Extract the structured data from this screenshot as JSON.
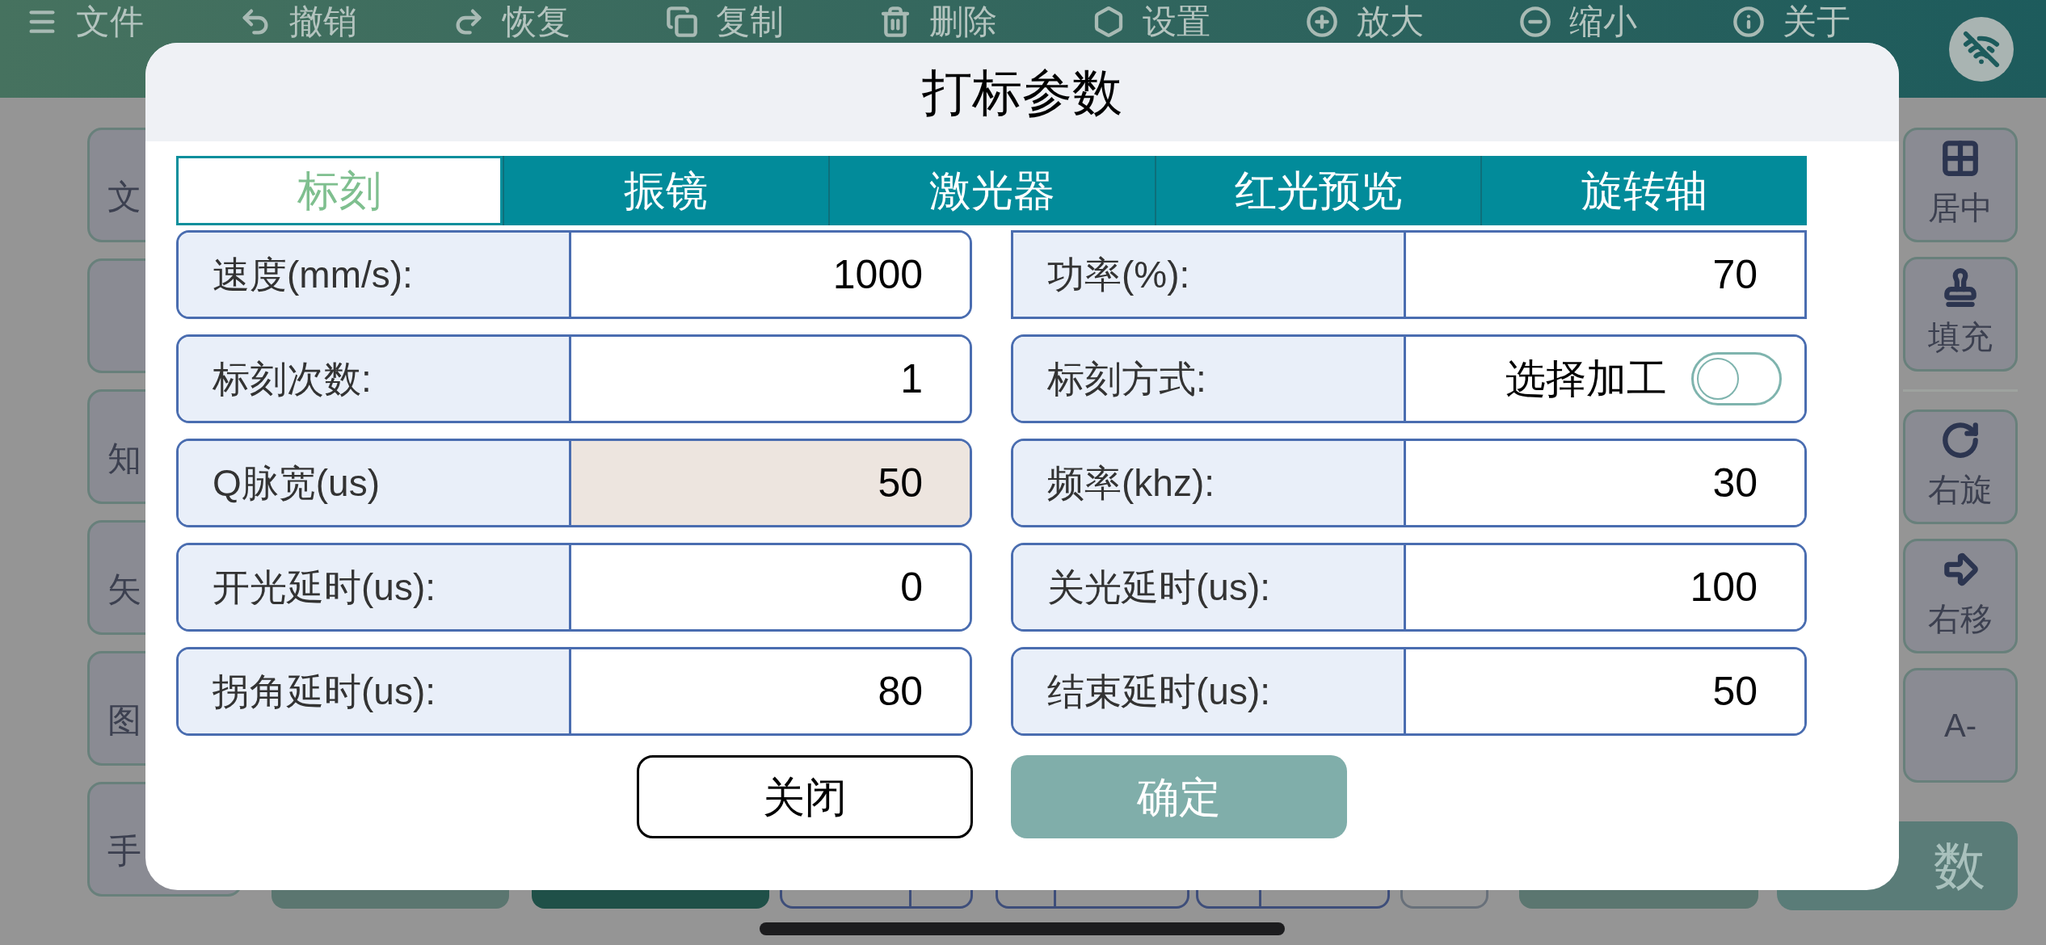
{
  "toolbar": {
    "items": [
      {
        "label": "文件"
      },
      {
        "label": "撤销"
      },
      {
        "label": "恢复"
      },
      {
        "label": "复制"
      },
      {
        "label": "删除"
      },
      {
        "label": "设置"
      },
      {
        "label": "放大"
      },
      {
        "label": "缩小"
      },
      {
        "label": "关于"
      }
    ]
  },
  "left_tools": [
    {
      "kind": "labeled",
      "label": "文"
    },
    {
      "kind": "blank"
    },
    {
      "kind": "labeled",
      "label": "知"
    },
    {
      "kind": "labeled",
      "label": "矢"
    },
    {
      "kind": "labeled",
      "label": "图"
    },
    {
      "kind": "labeled",
      "label": "手"
    }
  ],
  "right_tools": [
    {
      "label": "居中",
      "kind": "tool"
    },
    {
      "label": "填充",
      "kind": "tool"
    },
    {
      "label": "右旋",
      "kind": "tool"
    },
    {
      "label": "右移",
      "kind": "tool"
    },
    {
      "label": "A-",
      "kind": "tool"
    },
    {
      "label": "数",
      "kind": "primary"
    }
  ],
  "dialog": {
    "title": "打标参数",
    "tabs": [
      {
        "label": "标刻",
        "selected": true
      },
      {
        "label": "振镜",
        "selected": false
      },
      {
        "label": "激光器",
        "selected": false
      },
      {
        "label": "红光预览",
        "selected": false
      },
      {
        "label": "旋转轴",
        "selected": false
      }
    ],
    "fields": [
      {
        "kind": "input",
        "label": "速度(mm/s):",
        "value": "1000",
        "focused": false
      },
      {
        "kind": "input",
        "label": "功率(%):",
        "value": "70",
        "focused": false
      },
      {
        "kind": "input",
        "label": "标刻次数:",
        "value": "1",
        "focused": false
      },
      {
        "kind": "toggle",
        "label": "标刻方式:",
        "value": "选择加工",
        "on": false,
        "focused": false
      },
      {
        "kind": "input",
        "label": "Q脉宽(us)",
        "value": "50",
        "focused": true
      },
      {
        "kind": "input",
        "label": "频率(khz):",
        "value": "30",
        "focused": false
      },
      {
        "kind": "input",
        "label": "开光延时(us):",
        "value": "0",
        "focused": false
      },
      {
        "kind": "input",
        "label": "关光延时(us):",
        "value": "100",
        "focused": false
      },
      {
        "kind": "input",
        "label": "拐角延时(us):",
        "value": "80",
        "focused": false
      },
      {
        "kind": "input",
        "label": "结束延时(us):",
        "value": "50",
        "focused": false
      }
    ],
    "buttons": [
      {
        "label": "关闭",
        "kind": "secondary"
      },
      {
        "label": "确定",
        "kind": "primary"
      }
    ]
  }
}
